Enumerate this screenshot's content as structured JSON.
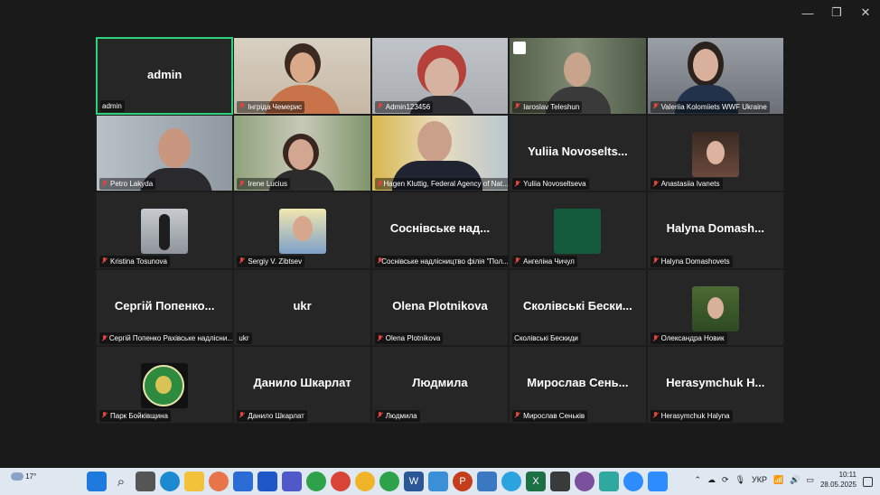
{
  "window": {
    "minimize": "—",
    "maximize": "❐",
    "close": "✕"
  },
  "tiles": [
    {
      "big": "admin",
      "label": "admin"
    },
    {
      "label": "Інгріда Чемерис"
    },
    {
      "label": "Admin123456"
    },
    {
      "label": "Iaroslav Teleshun"
    },
    {
      "label": "Valeriia Kolomiiets WWF Ukraine"
    },
    {
      "label": "Petro Lakyda"
    },
    {
      "label": "Irene Lucius"
    },
    {
      "label": "Hagen Kluttig, Federal Agency of Nat..."
    },
    {
      "big": "Yuliia  Novoselts...",
      "label": "Yuliia Novoseltseva"
    },
    {
      "label": "Anastasiia Ivanets"
    },
    {
      "label": "Kristina Tosunova"
    },
    {
      "label": "Sergiy V. Zibtsev"
    },
    {
      "big": "Соснівське над...",
      "label": "Соснівське надлісництво філія \"Пол..."
    },
    {
      "label": "Ангеліна Чичул"
    },
    {
      "big": "Halyna  Domash...",
      "label": "Halyna Domashovets"
    },
    {
      "big": "Сергій  Попенко...",
      "label": "Сергій Попенко Рахівське надлісни..."
    },
    {
      "big": "ukr",
      "label": "ukr"
    },
    {
      "big": "Olena Plotnikova",
      "label": "Olena Plotnikova"
    },
    {
      "big": "Сколівські Бески...",
      "label": "Сколівські Бескиди"
    },
    {
      "label": "Олександра Новик"
    },
    {
      "label": "Парк Бойківщина"
    },
    {
      "big": "Данило Шкарлат",
      "label": "Данило Шкарлат"
    },
    {
      "big": "Людмила",
      "label": "Людмила"
    },
    {
      "big": "Мирослав  Сень...",
      "label": "Мирослав Сеньків"
    },
    {
      "big": "Herasymchuk  H...",
      "label": "Herasymchuk Halyna"
    }
  ],
  "taskbar": {
    "weather": "17°",
    "lang": "УКР",
    "time": "10:11",
    "date": "28.05.2025"
  }
}
